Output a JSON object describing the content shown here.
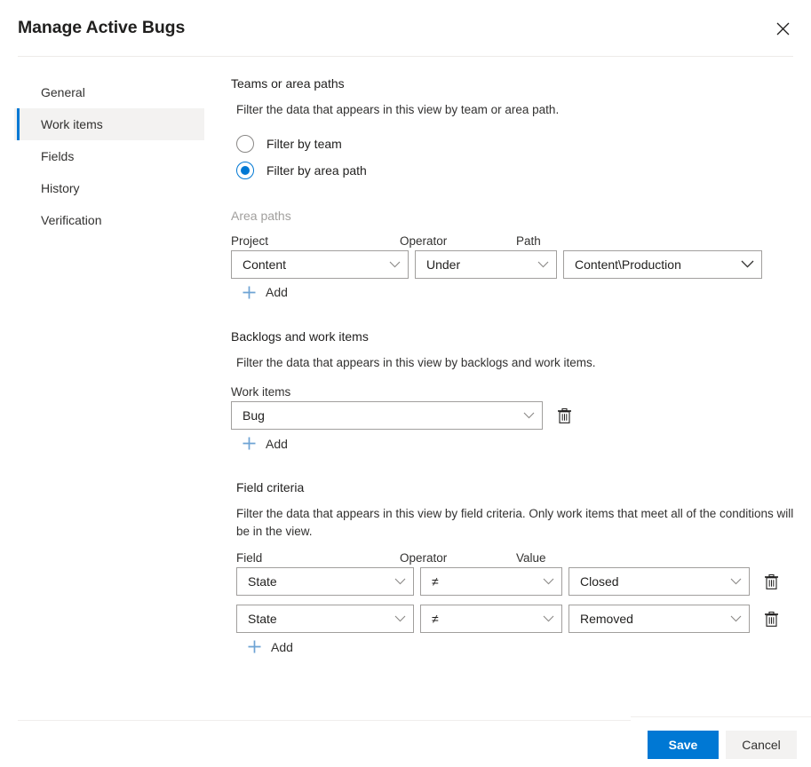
{
  "dialog": {
    "title": "Manage Active Bugs",
    "close_label": "Close"
  },
  "sidebar": {
    "items": [
      {
        "label": "General",
        "selected": false
      },
      {
        "label": "Work items",
        "selected": true
      },
      {
        "label": "Fields",
        "selected": false
      },
      {
        "label": "History",
        "selected": false
      },
      {
        "label": "Verification",
        "selected": false
      }
    ]
  },
  "teams_section": {
    "title": "Teams or area paths",
    "description": "Filter the data that appears in this view by team or area path.",
    "options": [
      {
        "label": "Filter by team",
        "selected": false
      },
      {
        "label": "Filter by area path",
        "selected": true
      }
    ],
    "area_paths_label": "Area paths",
    "columns": {
      "project": "Project",
      "operator": "Operator",
      "path": "Path"
    },
    "row": {
      "project": "Content",
      "operator": "Under",
      "path": "Content\\Production"
    },
    "add_label": "Add"
  },
  "backlogs_section": {
    "title": "Backlogs and work items",
    "description": "Filter the data that appears in this view by backlogs and work items.",
    "work_items_label": "Work items",
    "row": {
      "value": "Bug"
    },
    "add_label": "Add"
  },
  "field_criteria_section": {
    "title": "Field criteria",
    "description": "Filter the data that appears in this view by field criteria. Only work items that meet all of the conditions will be in the view.",
    "columns": {
      "field": "Field",
      "operator": "Operator",
      "value": "Value"
    },
    "rows": [
      {
        "field": "State",
        "operator": "≠",
        "value": "Closed"
      },
      {
        "field": "State",
        "operator": "≠",
        "value": "Removed"
      }
    ],
    "add_label": "Add"
  },
  "footer": {
    "save_label": "Save",
    "cancel_label": "Cancel"
  },
  "colors": {
    "accent": "#0078d4",
    "selected_nav_bg": "#f3f2f1",
    "border": "#a19f9d",
    "muted_text": "#a19f9d",
    "add_icon": "#6da3d4"
  }
}
